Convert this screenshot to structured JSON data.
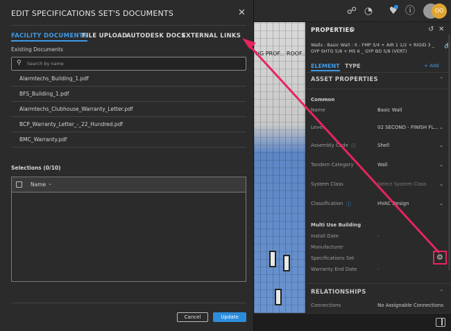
{
  "dialog": {
    "title": "EDIT SPECIFICATIONS SET'S DOCUMENTS",
    "tabs": [
      {
        "label": "FACILITY DOCUMENTS",
        "active": true
      },
      {
        "label": "FILE UPLOAD",
        "active": false
      },
      {
        "label": "AUTODESK DOCS",
        "active": false
      },
      {
        "label": "EXTERNAL LINKS",
        "active": false
      }
    ],
    "existing_label": "Existing Documents",
    "search_placeholder": "Search by name",
    "documents": [
      "Alarmtechs_Building_1.pdf",
      "BFS_Building_1.pdf",
      "Alarmtechs_Clubhouse_Warranty_Letter.pdf",
      "BCP_Warranty_Letter_-_22_Hundred.pdf",
      "BMC_Warranty.pdf"
    ],
    "selections_label": "Selections (0/10)",
    "selections_column": "Name",
    "cancel_label": "Cancel",
    "update_label": "Update"
  },
  "properties": {
    "title": "PROPERTIES",
    "subtitle": "Walls : Basic Wall : X - FMP 3/4 + AIR 1 1/2 + RIGID 3 _ GYP SHTG 5/8 + MS 6 _ GYP BD 5/8 (VERT)",
    "tabs": {
      "element": "ELEMENT",
      "type": "TYPE",
      "add": "+ Add"
    },
    "asset_properties": "ASSET PROPERTIES",
    "common_group": "Common",
    "common_rows": [
      {
        "label": "Name",
        "value": "Basic Wall",
        "dropdown": false,
        "info": false,
        "muted": false
      },
      {
        "label": "Level",
        "value": "02 SECOND - FINISH FL...",
        "dropdown": true,
        "info": false,
        "muted": false
      },
      {
        "label": "Assembly Code",
        "value": "Shell",
        "dropdown": true,
        "info": true,
        "muted": false
      },
      {
        "label": "Tandem Category",
        "value": "Wall",
        "dropdown": true,
        "info": false,
        "muted": false
      },
      {
        "label": "System Class",
        "value": "Select System Class",
        "dropdown": true,
        "info": false,
        "muted": true
      },
      {
        "label": "Classification",
        "value": "HVAC Design",
        "dropdown": true,
        "info": true,
        "muted": false
      }
    ],
    "multi_use_group": "Multi Use Building",
    "multi_use_rows": [
      {
        "label": "Install Date",
        "value": "-"
      },
      {
        "label": "Manufacturer",
        "value": ""
      },
      {
        "label": "Specifications Set",
        "value": ""
      },
      {
        "label": "Warranty End Date",
        "value": "-"
      }
    ],
    "relationships": "RELATIONSHIPS",
    "connections_label": "Connections",
    "connections_value": "No Assignable Connections"
  },
  "avatar_initials": "OO",
  "viewport_label": "NG PROF... ROOF...",
  "accent_color": "#3f9be6",
  "highlight_color": "#e8245e"
}
